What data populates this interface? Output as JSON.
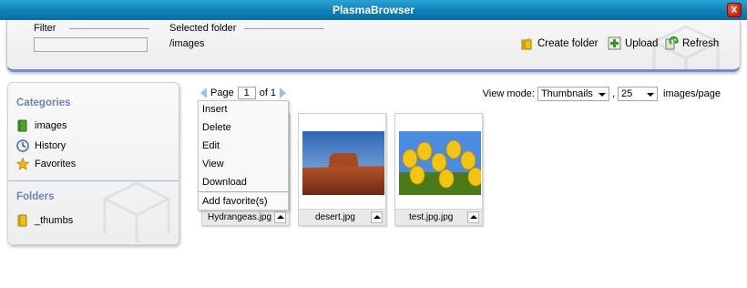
{
  "window": {
    "title": "PlasmaBrowser",
    "close_label": "X"
  },
  "toolbar": {
    "filter_label": "Filter",
    "filter_value": "",
    "selected_folder_label": "Selected folder",
    "selected_folder_value": "/images",
    "create_folder_label": "Create folder",
    "upload_label": "Upload",
    "refresh_label": "Refresh"
  },
  "sidebar": {
    "categories_heading": "Categories",
    "categories": [
      {
        "label": "images",
        "icon": "folder-green-icon"
      },
      {
        "label": "History",
        "icon": "clock-icon"
      },
      {
        "label": "Favorites",
        "icon": "star-icon"
      }
    ],
    "folders_heading": "Folders",
    "folders": [
      {
        "label": "_thumbs",
        "icon": "folder-yellow-icon"
      }
    ]
  },
  "pager": {
    "page_label": "Page",
    "current_page": "1",
    "of_label": "of 1"
  },
  "view": {
    "mode_label": "View mode:",
    "mode_value": "Thumbnails",
    "separator": ",",
    "per_page_value": "25",
    "per_page_label": "images/page"
  },
  "thumbnails": [
    {
      "filename": "Hydrangeas.jpg"
    },
    {
      "filename": "desert.jpg"
    },
    {
      "filename": "test.jpg.jpg"
    }
  ],
  "context_menu": {
    "items": [
      "Insert",
      "Delete",
      "Edit",
      "View",
      "Download"
    ],
    "extra_item": "Add favorite(s)"
  },
  "colors": {
    "titlebar": "#0f7fb7",
    "accent_blue": "#6a83b8",
    "toolbar_border": "#6d8fcf"
  }
}
